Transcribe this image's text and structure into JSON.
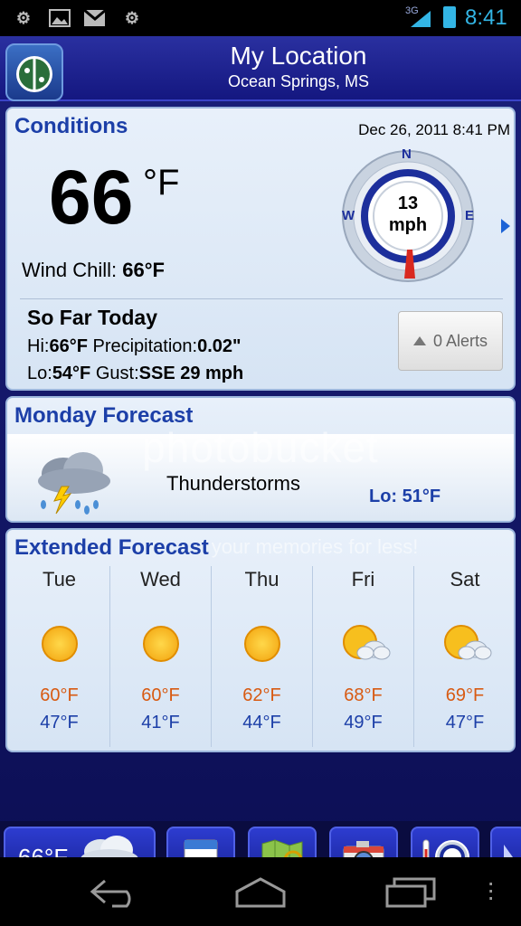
{
  "status_bar": {
    "network": "3G",
    "time": "8:41"
  },
  "header": {
    "title": "My Location",
    "subtitle": "Ocean Springs, MS"
  },
  "conditions": {
    "title": "Conditions",
    "datetime": "Dec 26, 2011 8:41 PM",
    "temp": "66",
    "temp_unit": "°F",
    "wind_chill_label": "Wind Chill:",
    "wind_chill_value": "66°F",
    "compass": {
      "n": "N",
      "e": "E",
      "w": "W",
      "speed": "13",
      "speed_unit": "mph"
    },
    "so_far_title": "So Far Today",
    "hi_label": "Hi:",
    "hi_value": "66°F",
    "precip_label": "Precipitation:",
    "precip_value": "0.02\"",
    "lo_label": "Lo:",
    "lo_value": "54°F",
    "gust_label": "Gust:",
    "gust_value": "SSE 29 mph",
    "alerts_label": "0 Alerts"
  },
  "forecast": {
    "title": "Monday Forecast",
    "condition": "Thunderstorms",
    "lo": "Lo: 51°F"
  },
  "extended": {
    "title": "Extended Forecast",
    "days": [
      {
        "name": "Tue",
        "icon": "sun",
        "hi": "60°F",
        "lo": "47°F"
      },
      {
        "name": "Wed",
        "icon": "sun",
        "hi": "60°F",
        "lo": "41°F"
      },
      {
        "name": "Thu",
        "icon": "sun",
        "hi": "62°F",
        "lo": "44°F"
      },
      {
        "name": "Fri",
        "icon": "partly-cloudy",
        "hi": "68°F",
        "lo": "49°F"
      },
      {
        "name": "Sat",
        "icon": "partly-cloudy",
        "hi": "69°F",
        "lo": "47°F"
      }
    ]
  },
  "toolbar": {
    "current_temp": "66°F"
  },
  "watermark": {
    "brand": "photobucket",
    "tagline": "your memories for less!"
  }
}
